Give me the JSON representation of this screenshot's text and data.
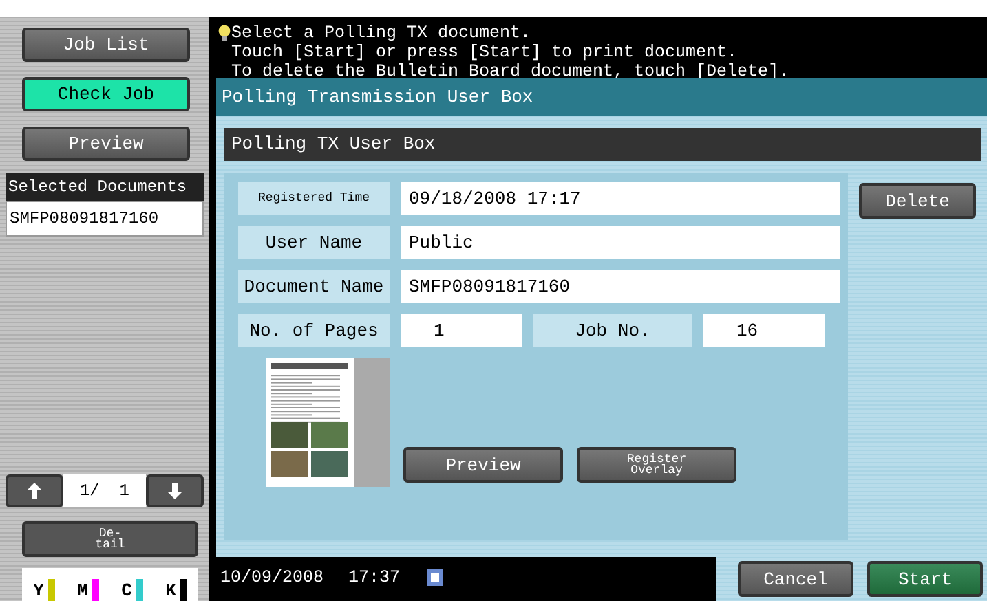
{
  "sidebar": {
    "nav_buttons": [
      {
        "label": "Job List",
        "selected": false
      },
      {
        "label": "Check Job",
        "selected": true
      },
      {
        "label": "Preview",
        "selected": false
      }
    ],
    "selected_documents": {
      "title": "Selected Documents",
      "items": [
        "SMFP08091817160"
      ]
    },
    "pager": {
      "text": "1/  1"
    },
    "detail_button": "De-\ntail",
    "toners": [
      {
        "label": "Y",
        "color": "#c8c800"
      },
      {
        "label": "M",
        "color": "#ff00ff"
      },
      {
        "label": "C",
        "color": "#33cccc"
      },
      {
        "label": "K",
        "color": "#000000"
      }
    ]
  },
  "message": [
    "Select a Polling TX document.",
    "Touch [Start] or press [Start] to print document.",
    "To delete the Bulletin Board document, touch [Delete]."
  ],
  "panel": {
    "title": "Polling Transmission User Box",
    "subtitle": "Polling TX User Box",
    "fields": [
      {
        "label": "Registered Time",
        "value": "09/18/2008 17:17",
        "kind": "small"
      },
      {
        "label": "User Name",
        "value": "Public",
        "kind": "normal"
      },
      {
        "label": "Document Name",
        "value": "SMFP08091817160",
        "kind": "normal"
      }
    ],
    "pages": {
      "label": "No. of Pages",
      "value": "1"
    },
    "job": {
      "label": "Job No.",
      "value": "16"
    },
    "delete_button": "Delete",
    "preview_button": "Preview",
    "overlay_button": "Register\nOverlay"
  },
  "status_bar": {
    "date": "10/09/2008",
    "time": "17:37"
  },
  "buttons": {
    "cancel": "Cancel",
    "start": "Start"
  }
}
